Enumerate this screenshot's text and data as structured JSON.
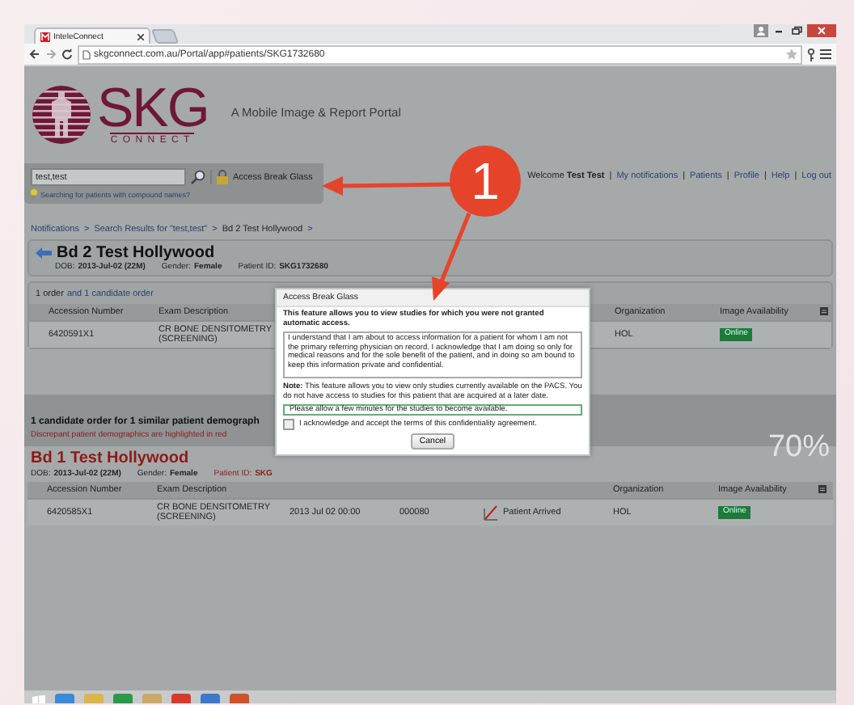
{
  "browser": {
    "tab_title": "InteleConnect",
    "url": "skgconnect.com.au/Portal/app#patients/SKG1732680"
  },
  "header": {
    "logo_main": "SKG",
    "logo_sub": "CONNECT",
    "tagline": "A Mobile Image & Report Portal"
  },
  "search": {
    "value": "test,test",
    "hint": "Searching for patients with compound names?",
    "break_glass": "Access Break Glass"
  },
  "user_nav": {
    "welcome": "Welcome **Test Test**",
    "separator": "|",
    "links": [
      "My notifications",
      "Patients",
      "Profile",
      "Help",
      "Log out"
    ]
  },
  "breadcrumbs": {
    "separator": ">",
    "items": [
      "Notifications",
      "Search Results for \"test,test\"",
      "Bd 2 Test Hollywood"
    ]
  },
  "patient": {
    "name": "Bd 2 Test Hollywood",
    "fields": [
      {
        "label": "DOB:",
        "value": "2013-Jul-02 (22M)",
        "discrepant": false
      },
      {
        "label": "Gender:",
        "value": "Female",
        "discrepant": false
      },
      {
        "label": "Patient ID:",
        "value": "SKG1732680",
        "discrepant": false
      }
    ]
  },
  "orders": {
    "summary": "1 order",
    "candidate_link": "and 1 candidate order",
    "columns": [
      "Accession Number",
      "Exam Description",
      "",
      "",
      "",
      "Organization",
      "Image Availability"
    ],
    "rows": [
      {
        "cells": [
          "6420591X1",
          "CR BONE DENSITOMETRY (SCREENING)",
          "",
          "",
          "",
          "HOL"
        ],
        "availability": "Online"
      }
    ]
  },
  "candidates": {
    "title": "1 candidate order for 1 similar patient demograph",
    "subtitle": "Discrepant patient demographics are highlighted in red",
    "match": "70%",
    "patient": {
      "name": "Bd 1 Test Hollywood",
      "fields": [
        {
          "label": "DOB:",
          "value": "2013-Jul-02 (22M)",
          "discrepant": false
        },
        {
          "label": "Gender:",
          "value": "Female",
          "discrepant": false
        },
        {
          "label": "Patient ID:",
          "value": "SKG",
          "discrepant": true
        }
      ]
    },
    "columns": [
      "Accession Number",
      "Exam Description",
      "",
      "",
      "",
      "Organization",
      "Image Availability"
    ],
    "rows": [
      {
        "cells": [
          "6420585X1",
          "CR BONE DENSITOMETRY (SCREENING)",
          "2013 Jul 02 00:00",
          "000080",
          "Patient Arrived",
          "HOL"
        ],
        "availability": "Online",
        "status_icon": true
      }
    ]
  },
  "dialog": {
    "title": "Access Break Glass",
    "intro": "This feature allows you to view studies for which you were not granted automatic access.",
    "agreement": "I understand that I am about to access information for a patient for whom I am not the primary referring physician on record. I acknowledge that I am doing so only for medical reasons and for the sole benefit of the patient, and in doing so am bound to keep this information private and confidential.",
    "note": "**Note:** This feature allows you to view only studies currently available on the PACS. You do not have access to studies for this patient that are acquired at a later date.",
    "status": "Please allow a few minutes for the studies to become available.",
    "checkbox": {
      "label": "I acknowledge and accept the terms of this confidentiality agreement.",
      "checked": false
    },
    "button": "Cancel"
  },
  "callout": {
    "number": "1"
  }
}
